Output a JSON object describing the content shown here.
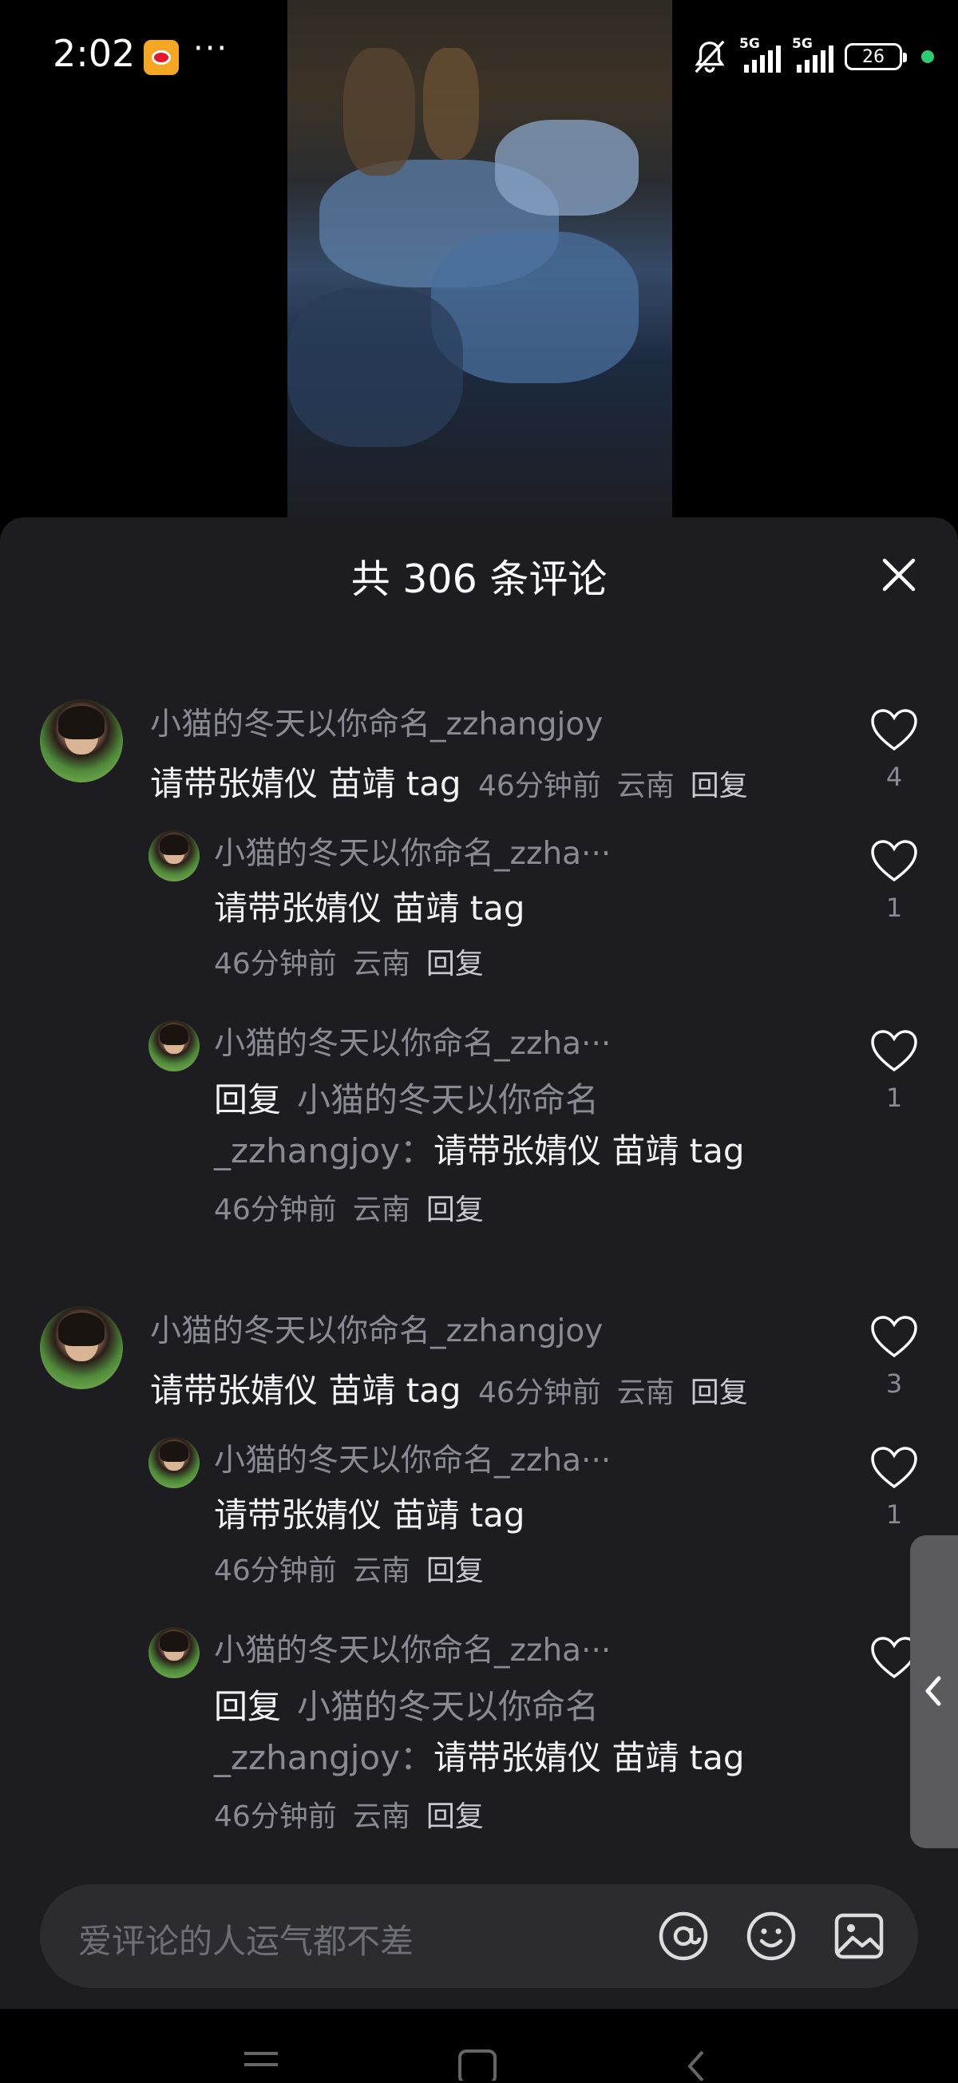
{
  "status_bar": {
    "time": "2:02",
    "more": "···",
    "signal1_label": "5G",
    "signal2_label": "5G",
    "battery": "26"
  },
  "sheet": {
    "title": "共 306 条评论"
  },
  "comments": [
    {
      "user": "小猫的冬天以你命名_zzhangjoy",
      "text": "请带张婧仪 苗靖 tag",
      "time": "46分钟前",
      "location": "云南",
      "reply_label": "回复",
      "likes": "4",
      "replies": [
        {
          "user": "小猫的冬天以你命名_zzha···",
          "text": "请带张婧仪 苗靖 tag",
          "time": "46分钟前",
          "location": "云南",
          "reply_label": "回复",
          "likes": "1"
        },
        {
          "user": "小猫的冬天以你命名_zzha···",
          "reply_prefix": "回复",
          "reply_to_line1": "小猫的冬天以你命名",
          "reply_to_line2": "_zzhangjoy",
          "text": "请带张婧仪 苗靖 tag",
          "time": "46分钟前",
          "location": "云南",
          "reply_label": "回复",
          "likes": "1"
        }
      ]
    },
    {
      "user": "小猫的冬天以你命名_zzhangjoy",
      "text": "请带张婧仪 苗靖 tag",
      "time": "46分钟前",
      "location": "云南",
      "reply_label": "回复",
      "likes": "3",
      "replies": [
        {
          "user": "小猫的冬天以你命名_zzha···",
          "text": "请带张婧仪 苗靖 tag",
          "time": "46分钟前",
          "location": "云南",
          "reply_label": "回复",
          "likes": "1"
        },
        {
          "user": "小猫的冬天以你命名_zzha···",
          "reply_prefix": "回复",
          "reply_to_line1": "小猫的冬天以你命名",
          "reply_to_line2": "_zzhangjoy",
          "text": "请带张婧仪 苗靖 tag",
          "time": "46分钟前",
          "location": "云南",
          "reply_label": "回复"
        }
      ]
    }
  ],
  "input": {
    "placeholder": "爱评论的人运气都不差"
  },
  "colors": {
    "sheet_bg": "#1c1c21",
    "input_bg": "#2b2b30",
    "muted_text": "#8a8a93"
  }
}
